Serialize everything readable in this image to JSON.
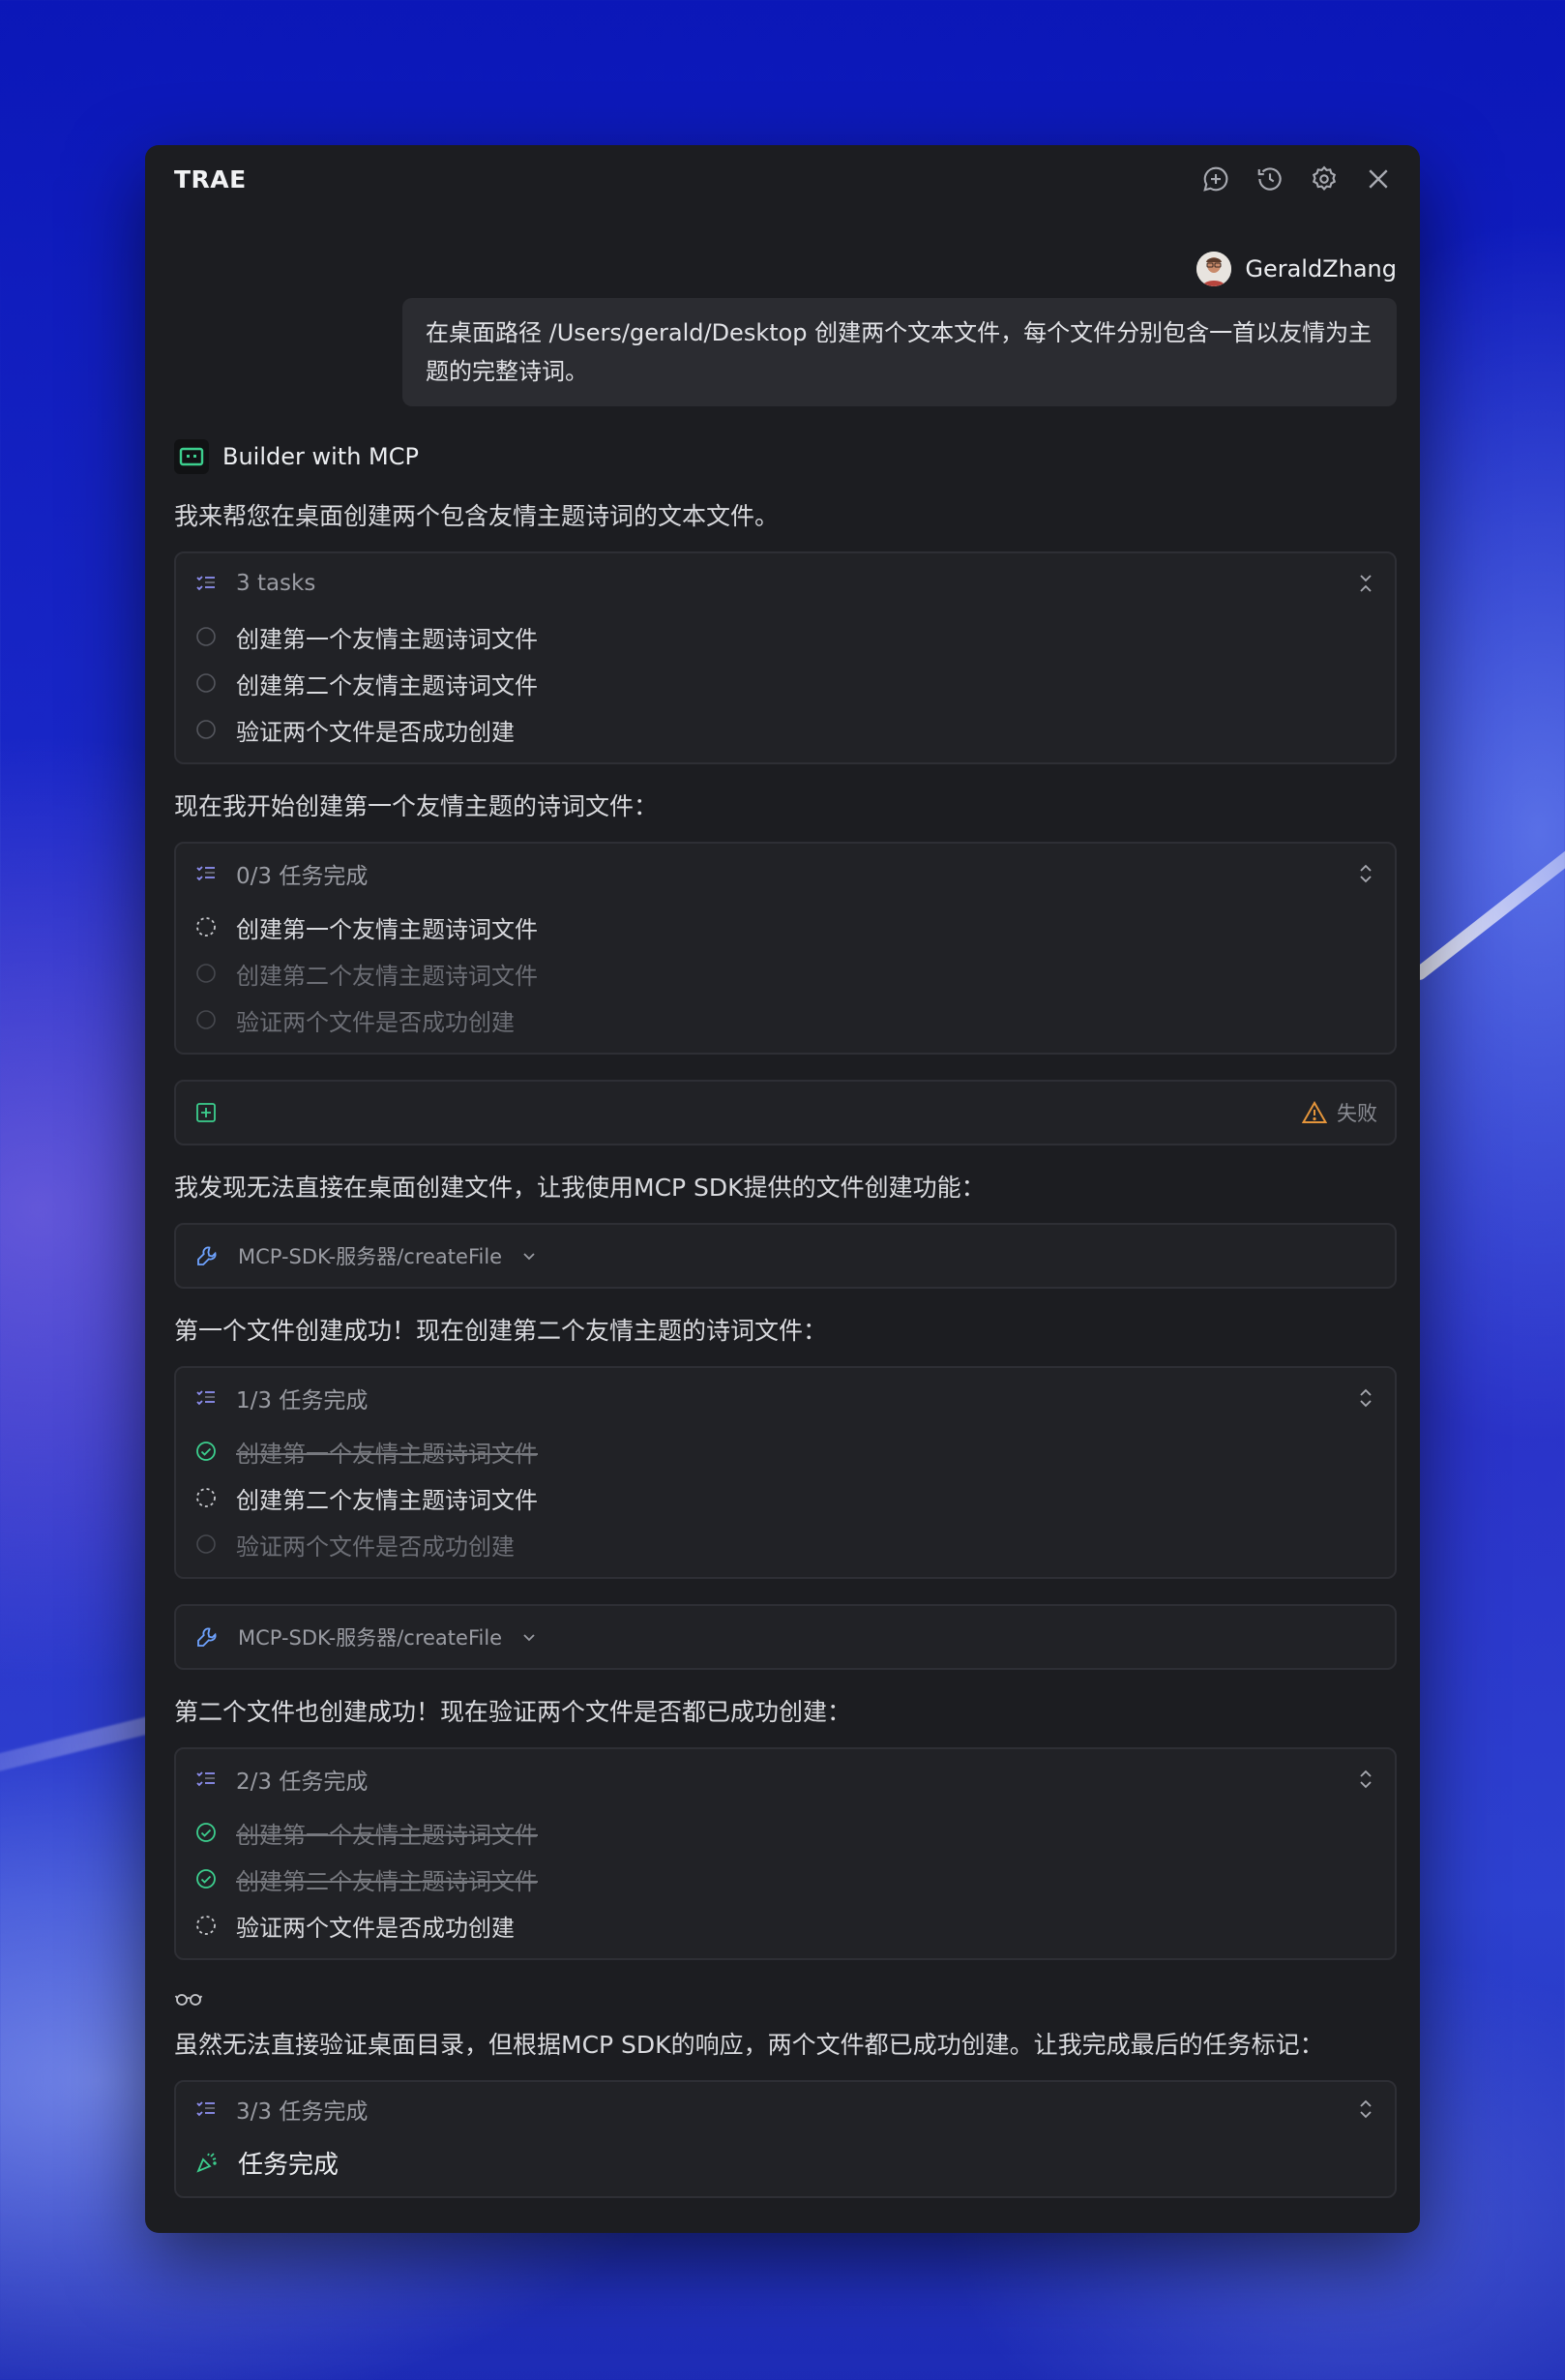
{
  "window": {
    "title": "TRAE"
  },
  "titlebar_icons": [
    "new-chat-icon",
    "history-icon",
    "settings-icon",
    "close-icon"
  ],
  "user": {
    "name": "GeraldZhang",
    "message": "在桌面路径 /Users/gerald/Desktop 创建两个文本文件，每个文件分别包含一首以友情为主题的完整诗词。"
  },
  "assistant": {
    "name": "Builder with MCP"
  },
  "messages": {
    "intro": "我来帮您在桌面创建两个包含友情主题诗词的文本文件。",
    "start": "现在我开始创建第一个友情主题的诗词文件：",
    "fallback": "我发现无法直接在桌面创建文件，让我使用MCP SDK提供的文件创建功能：",
    "first_done": "第一个文件创建成功！现在创建第二个友情主题的诗词文件：",
    "second_done": "第二个文件也创建成功！现在验证两个文件是否都已成功创建：",
    "final": "虽然无法直接验证桌面目录，但根据MCP SDK的响应，两个文件都已成功创建。让我完成最后的任务标记："
  },
  "task_cards": [
    {
      "title": "3 tasks",
      "tasks": [
        {
          "label": "创建第一个友情主题诗词文件",
          "status": "pending"
        },
        {
          "label": "创建第二个友情主题诗词文件",
          "status": "pending"
        },
        {
          "label": "验证两个文件是否成功创建",
          "status": "pending"
        }
      ]
    },
    {
      "title": "0/3 任务完成",
      "tasks": [
        {
          "label": "创建第一个友情主题诗词文件",
          "status": "in-progress"
        },
        {
          "label": "创建第二个友情主题诗词文件",
          "status": "pending"
        },
        {
          "label": "验证两个文件是否成功创建",
          "status": "pending"
        }
      ]
    },
    {
      "title": "1/3 任务完成",
      "tasks": [
        {
          "label": "创建第一个友情主题诗词文件",
          "status": "done"
        },
        {
          "label": "创建第二个友情主题诗词文件",
          "status": "in-progress"
        },
        {
          "label": "验证两个文件是否成功创建",
          "status": "pending"
        }
      ]
    },
    {
      "title": "2/3 任务完成",
      "tasks": [
        {
          "label": "创建第一个友情主题诗词文件",
          "status": "done"
        },
        {
          "label": "创建第二个友情主题诗词文件",
          "status": "done"
        },
        {
          "label": "验证两个文件是否成功创建",
          "status": "in-progress"
        }
      ]
    },
    {
      "title": "3/3 任务完成",
      "tasks": [
        {
          "label": "任务完成",
          "status": "complete"
        }
      ]
    }
  ],
  "failed_tool": {
    "status": "失败"
  },
  "tool_calls": [
    {
      "label": "MCP-SDK-服务器/createFile"
    },
    {
      "label": "MCP-SDK-服务器/createFile"
    }
  ],
  "colors": {
    "accent_green": "#3ccf8e",
    "warning_orange": "#e5953b",
    "tool_blue": "#6fa3ff",
    "task_icon_purple": "#8e8ff0"
  }
}
